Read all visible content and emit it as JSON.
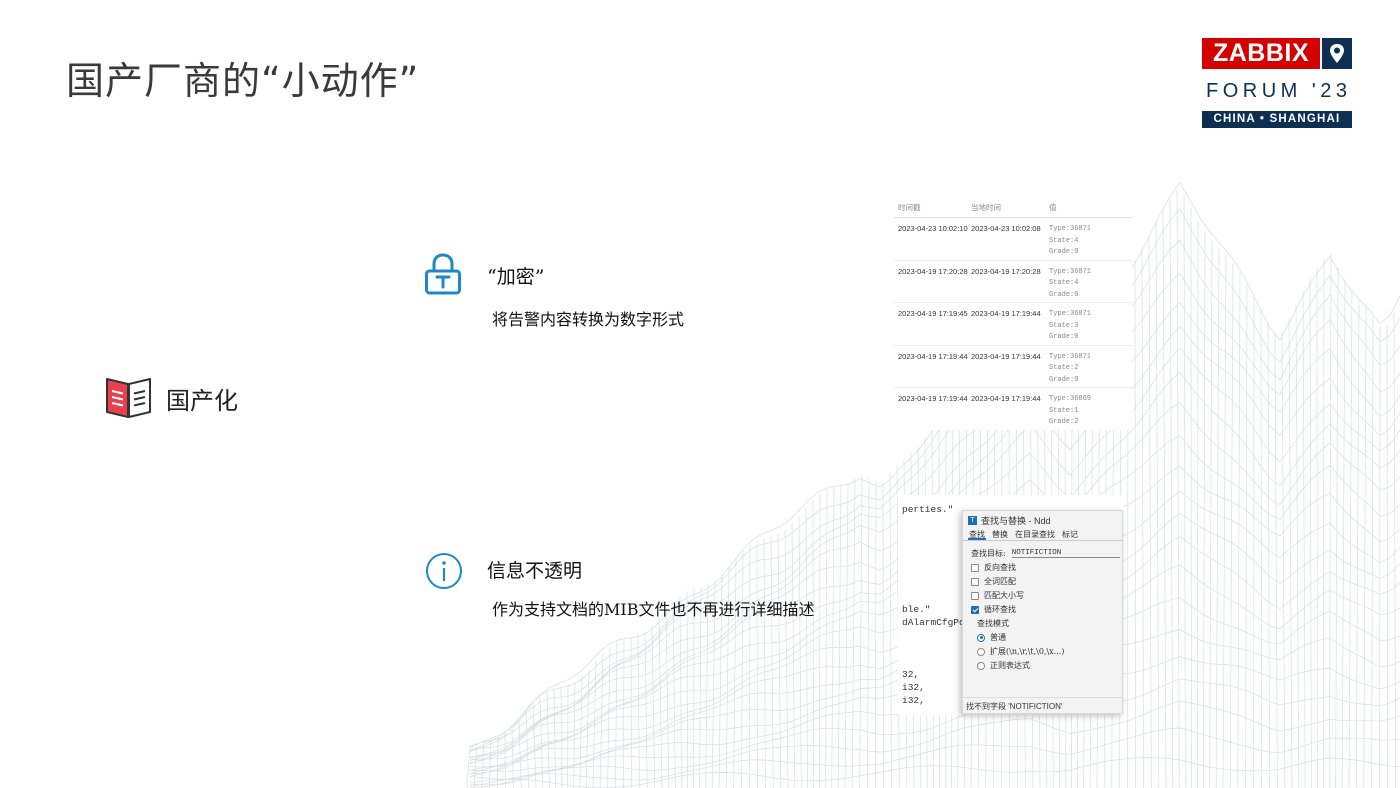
{
  "slide": {
    "title": "国产厂商的“小动作”"
  },
  "logo": {
    "brand": "ZABBIX",
    "event": "FORUM '23",
    "location": "CHINA • SHANGHAI",
    "brand_color": "#d40000",
    "navy_color": "#0d2f52"
  },
  "localization": {
    "icon": "book-icon",
    "label": "国产化",
    "icon_color": "#e8404d"
  },
  "encryption": {
    "icon": "lock-icon",
    "heading": "“加密”",
    "description": "将告警内容转换为数字形式",
    "icon_color": "#1e88c7"
  },
  "opacity": {
    "icon": "info-icon",
    "heading": "信息不透明",
    "description": "作为支持文档的MIB文件也不再进行详细描述",
    "icon_color": "#1e88c7"
  },
  "history_table": {
    "headers": [
      "时间戳",
      "当地时间",
      "值"
    ],
    "rows": [
      {
        "timestamp": "2023-04-23 10:02:10",
        "local": "2023-04-23 10:02:08",
        "type": "Type:36871",
        "state": "State:4",
        "grade": "Grade:0"
      },
      {
        "timestamp": "2023-04-19 17:20:28",
        "local": "2023-04-19 17:20:28",
        "type": "Type:36871",
        "state": "State:4",
        "grade": "Grade:0"
      },
      {
        "timestamp": "2023-04-19 17:19:45",
        "local": "2023-04-19 17:19:44",
        "type": "Type:36871",
        "state": "State:3",
        "grade": "Grade:0"
      },
      {
        "timestamp": "2023-04-19 17:19:44",
        "local": "2023-04-19 17:19:44",
        "type": "Type:36871",
        "state": "State:2",
        "grade": "Grade:0"
      },
      {
        "timestamp": "2023-04-19 17:19:44",
        "local": "2023-04-19 17:19:44",
        "type": "Type:36869",
        "state": "State:1",
        "grade": "Grade:2"
      }
    ]
  },
  "code_editor": {
    "lines": [
      "perties.\"",
      "ble.\"",
      "dAlarmCfgPo",
      "32,",
      "i32,",
      "i32,"
    ]
  },
  "find_dialog": {
    "title": "查找与替换 - Ndd",
    "tabs": [
      "查找",
      "替换",
      "在目录查找",
      "标记"
    ],
    "target_label": "查找目标:",
    "target_value": "NOTIFICTION",
    "options": [
      {
        "label": "反向查找",
        "checked": false
      },
      {
        "label": "全词匹配",
        "checked": false
      },
      {
        "label": "匹配大小写",
        "checked": false
      },
      {
        "label": "循环查找",
        "checked": true
      }
    ],
    "mode_label": "查找模式",
    "modes": [
      {
        "label": "普通",
        "selected": true
      },
      {
        "label": "扩展(\\n,\\r,\\t,\\0,\\x...)",
        "selected": false
      },
      {
        "label": "正则表达式",
        "selected": false
      }
    ],
    "status": "找不到字段 'NOTIFICTION'"
  }
}
